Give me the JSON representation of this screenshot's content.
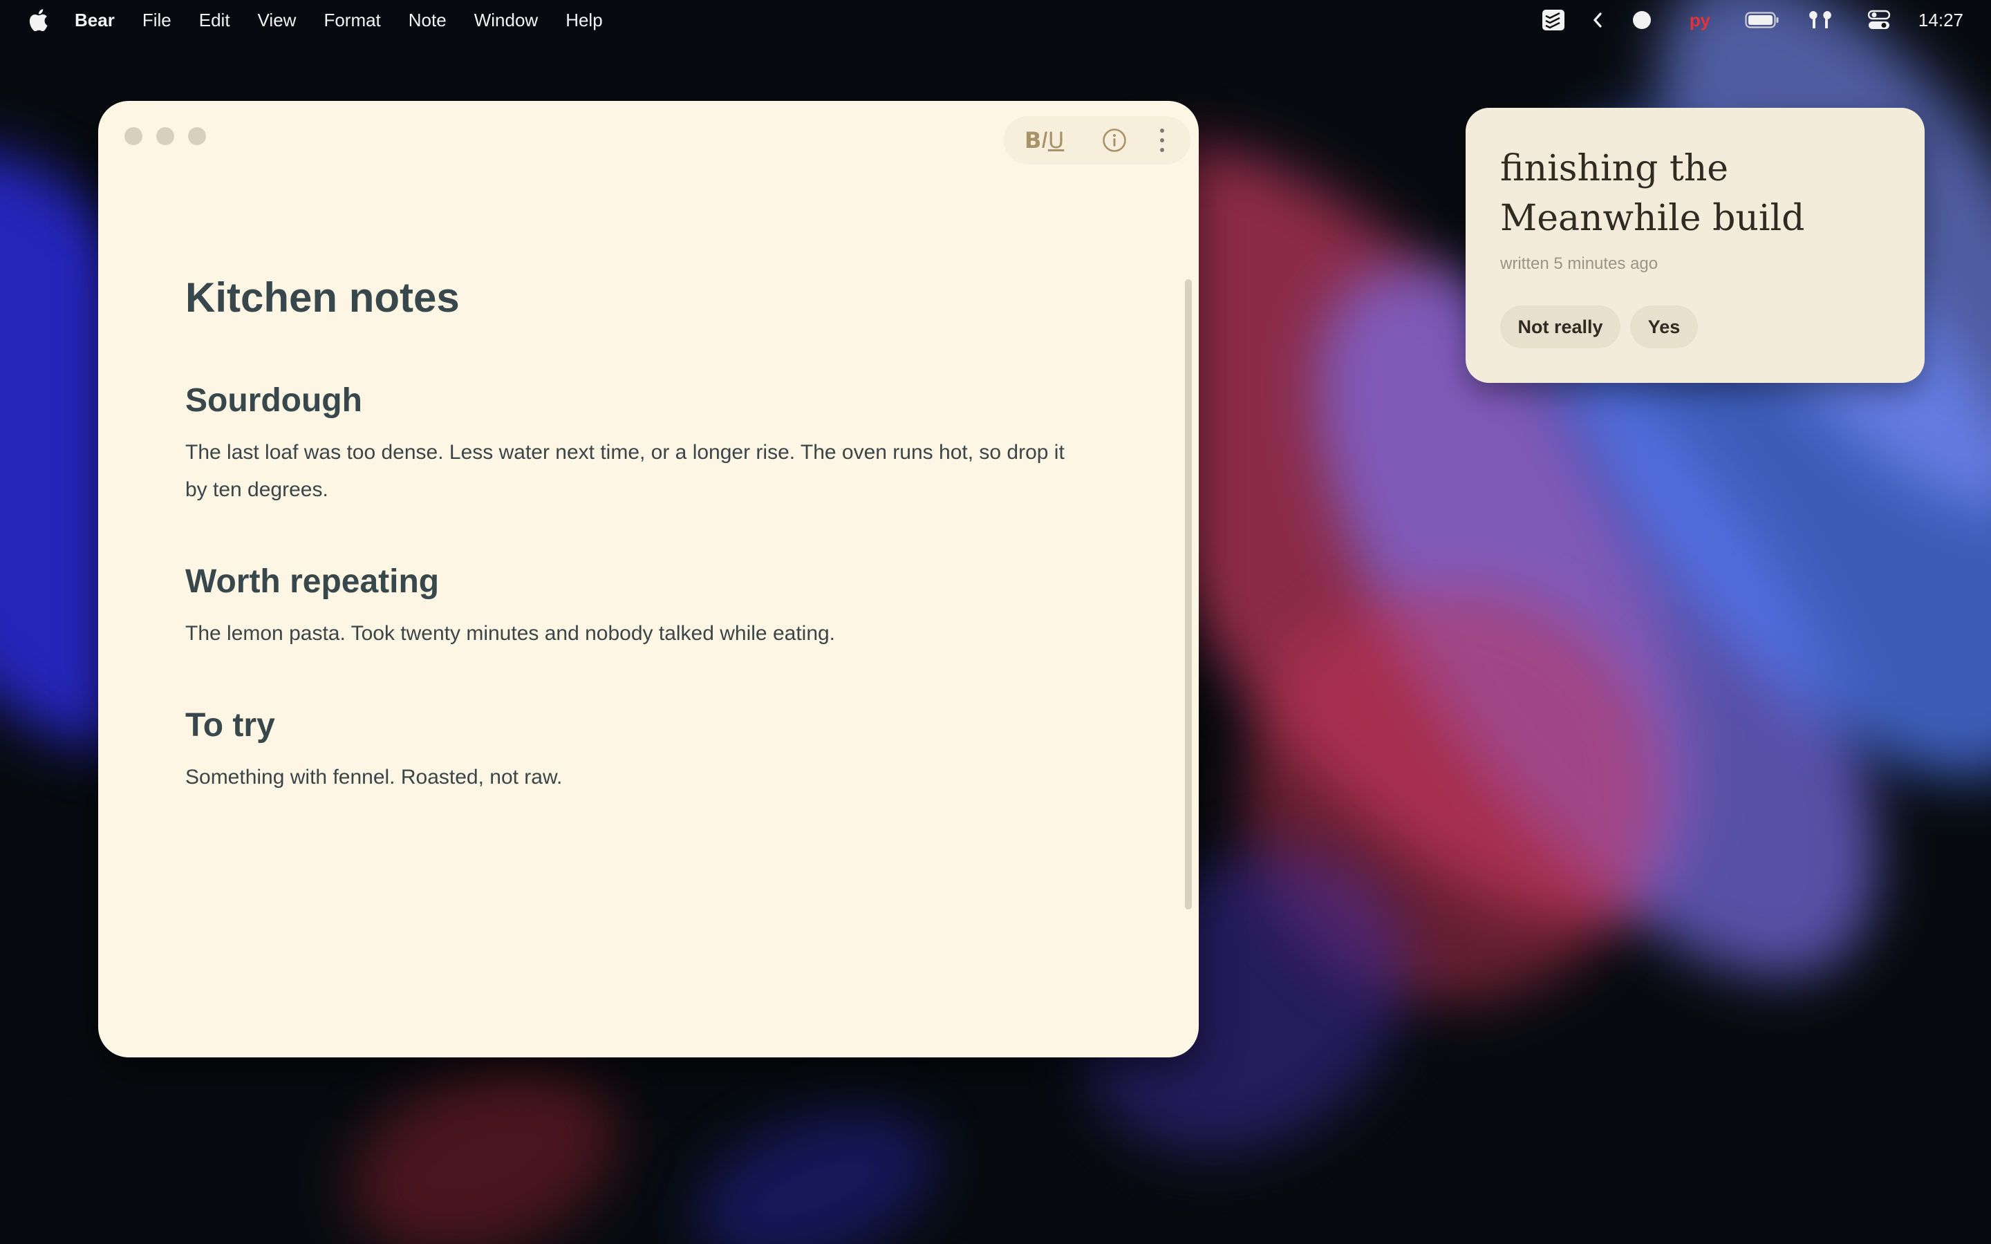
{
  "menubar": {
    "items": [
      "Bear",
      "File",
      "Edit",
      "View",
      "Format",
      "Note",
      "Window",
      "Help"
    ],
    "input_source": "ру",
    "clock": "14:27"
  },
  "note": {
    "title": "Kitchen notes",
    "sections": [
      {
        "heading": "Sourdough",
        "body": "The last loaf was too dense. Less water next time, or a longer rise. The oven runs hot, so drop it by ten degrees."
      },
      {
        "heading": "Worth repeating",
        "body": "The lemon pasta. Took twenty minutes and nobody talked while eating."
      },
      {
        "heading": "To try",
        "body": "Something with fennel. Roasted, not raw."
      }
    ],
    "toolbar": {
      "bold": "B",
      "italic": "I",
      "underline": "U"
    }
  },
  "notification": {
    "title": "finishing the Meanwhile build",
    "subtitle": "written 5 minutes ago",
    "buttons": [
      "Not really",
      "Yes"
    ]
  },
  "colors": {
    "window_bg": "#fdf6e4",
    "heading": "#38474b",
    "input_source_red": "#e2333a"
  }
}
